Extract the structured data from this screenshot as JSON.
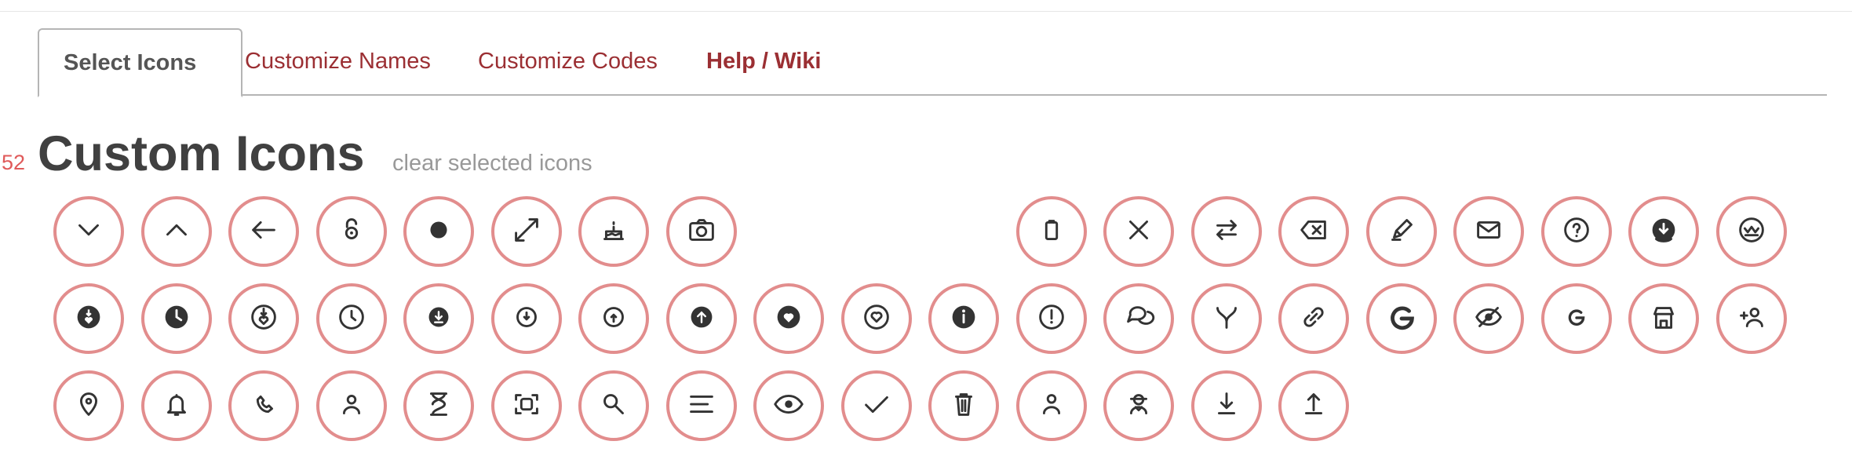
{
  "tabs": [
    {
      "label": "Select Icons"
    },
    {
      "label": "Customize Names"
    },
    {
      "label": "Customize Codes"
    },
    {
      "label": "Help / Wiki"
    }
  ],
  "header": {
    "count": "52",
    "title": "Custom Icons",
    "clear_link": "clear selected icons"
  },
  "colors": {
    "accent": "#9b2f33",
    "icon_border": "#e28d8d",
    "count": "#e05a5a",
    "icon_fg": "#333333"
  },
  "rows": [
    [
      "chevron-down-icon",
      "chevron-up-icon",
      "arrow-left-icon",
      "lock-open-icon",
      "record-icon",
      "expand-icon",
      "cake-icon",
      "camera-icon",
      null,
      null,
      null,
      "clipboard-icon",
      "close-icon",
      "swap-icon",
      "backspace-icon",
      "edit-icon",
      "mail-icon",
      "help-circle-icon",
      "download-circle-filled-icon",
      "crown-circle-icon"
    ],
    [
      "heart-down-circle-filled-icon",
      "clock-filled-icon",
      "heart-down-circle-icon",
      "clock-icon",
      "download-circle-filled-small-icon",
      "download-circle-icon",
      "upload-circle-small-icon",
      "upload-circle-filled-icon",
      "heart-circle-filled-icon",
      "heart-circle-icon",
      "info-circle-filled-icon",
      "info-circle-icon",
      "chat-icon",
      "fork-icon",
      "link-icon",
      "google-icon",
      "eye-off-icon",
      "google-small-icon",
      "store-icon",
      "add-user-icon"
    ],
    [
      "location-icon",
      "bell-icon",
      "phone-icon",
      "user-icon",
      "hourglass-icon",
      "face-scan-icon",
      "search-icon",
      "menu-icon",
      "eye-icon",
      "check-icon",
      "trash-icon",
      "person-icon",
      "spy-icon",
      "download-icon",
      "upload-icon"
    ]
  ]
}
